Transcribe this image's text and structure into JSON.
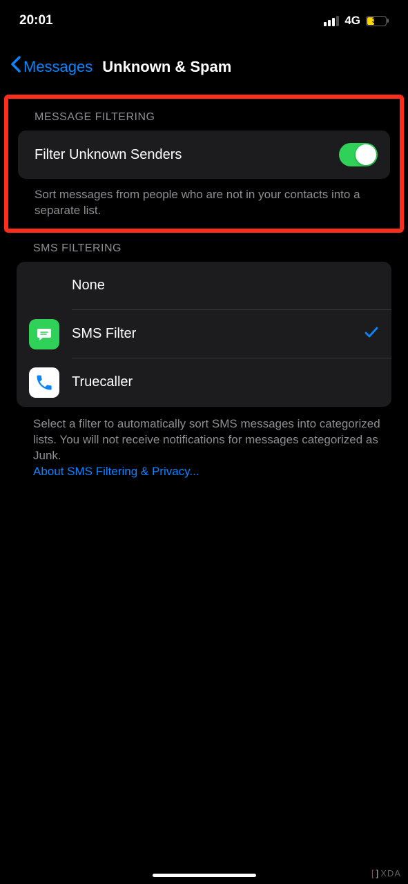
{
  "statusBar": {
    "time": "20:01",
    "network": "4G",
    "battery": "36"
  },
  "nav": {
    "backLabel": "Messages",
    "title": "Unknown & Spam"
  },
  "messageFiltering": {
    "header": "MESSAGE FILTERING",
    "rowLabel": "Filter Unknown Senders",
    "toggleOn": true,
    "footer": "Sort messages from people who are not in your contacts into a separate list."
  },
  "smsFiltering": {
    "header": "SMS FILTERING",
    "options": [
      {
        "label": "None",
        "icon": null,
        "selected": false
      },
      {
        "label": "SMS Filter",
        "icon": "sms",
        "selected": true
      },
      {
        "label": "Truecaller",
        "icon": "phone",
        "selected": false
      }
    ],
    "footer": "Select a filter to automatically sort SMS messages into categorized lists. You will not receive notifications for messages categorized as Junk.",
    "link": "About SMS Filtering & Privacy..."
  },
  "watermark": "XDA"
}
